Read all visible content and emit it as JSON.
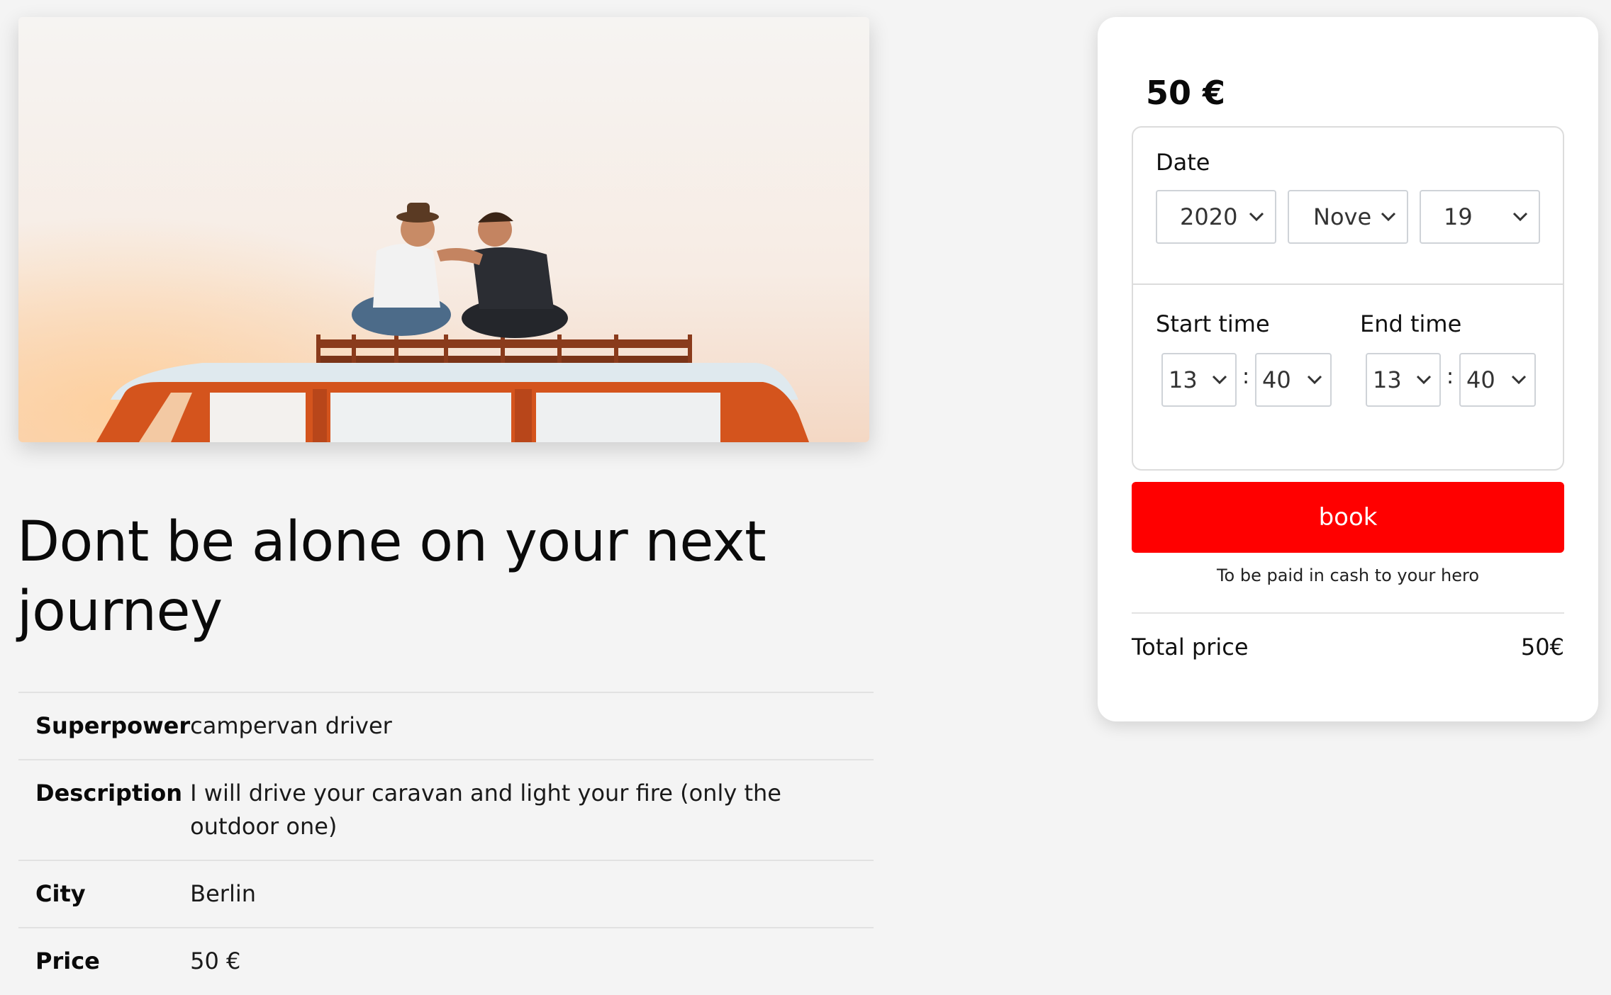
{
  "listing": {
    "image_alt": "two men sitting on the roof of an orange campervan at sunset",
    "title": "Dont be alone on your next journey",
    "details": [
      {
        "label": "Superpower",
        "value": "campervan driver"
      },
      {
        "label": "Description",
        "value": "I will drive your caravan and light your fire (only the outdoor one)"
      },
      {
        "label": "City",
        "value": "Berlin"
      },
      {
        "label": "Price",
        "value": "50 €"
      }
    ]
  },
  "booking": {
    "price": "50 €",
    "date_label": "Date",
    "date": {
      "year": "2020",
      "month": "Nove",
      "day": "19"
    },
    "start_label": "Start time",
    "end_label": "End time",
    "start": {
      "hour": "13",
      "minute": "40"
    },
    "end": {
      "hour": "13",
      "minute": "40"
    },
    "time_separator": ":",
    "book_label": "book",
    "payment_note": "To be paid in cash to your hero",
    "total_label": "Total price",
    "total_value": "50€",
    "accent_color": "#ff0000"
  },
  "icons": {
    "select_arrow": "chevron-down-icon"
  }
}
